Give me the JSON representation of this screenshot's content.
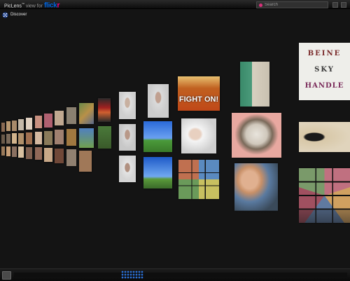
{
  "app": {
    "name": "PicLens",
    "trademark": "™",
    "view_for": "view for",
    "brand_blue": "flick",
    "brand_pink": "r"
  },
  "search": {
    "placeholder": "Search"
  },
  "discover": {
    "label": "Discover"
  },
  "photos": {
    "fight_on": "FIGHT ON!",
    "ransom_line1": "BEINE",
    "ransom_line2": "SKY",
    "ransom_line3": "HANDLE"
  },
  "colors": {
    "background": "#141414",
    "flickr_blue": "#0063dc",
    "flickr_pink": "#ff0084",
    "scroll_accent": "#2a6fd6"
  }
}
